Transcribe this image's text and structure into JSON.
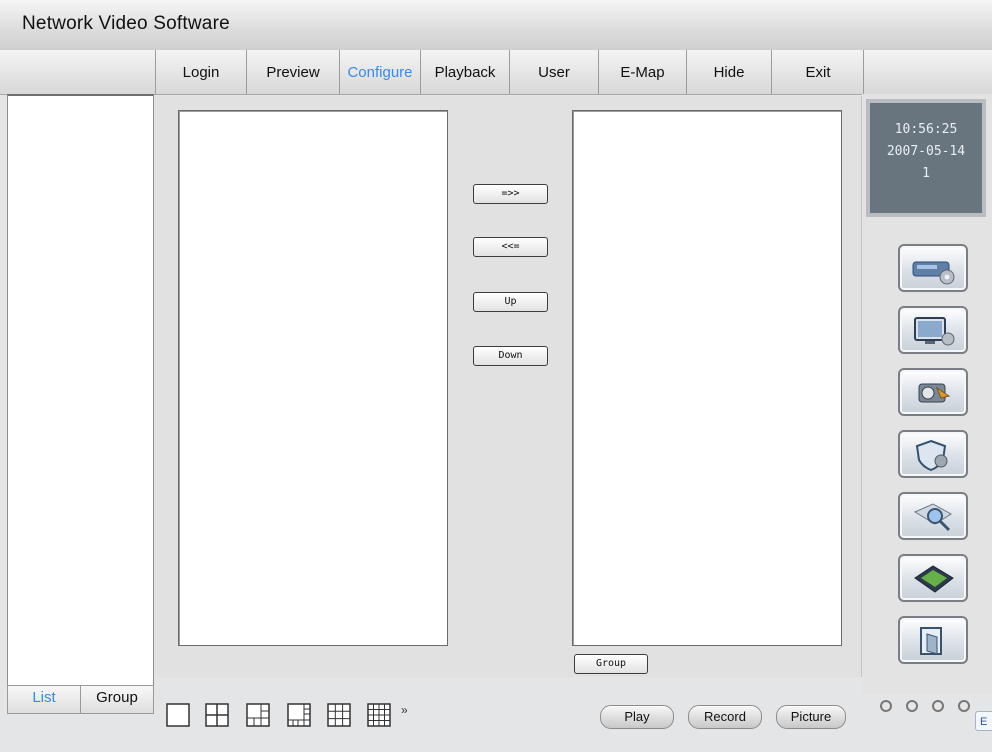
{
  "app": {
    "title": "Network Video Software"
  },
  "menu": {
    "items": [
      {
        "label": "Login"
      },
      {
        "label": "Preview"
      },
      {
        "label": "Configure",
        "active": true
      },
      {
        "label": "Playback"
      },
      {
        "label": "User"
      },
      {
        "label": "E-Map"
      },
      {
        "label": "Hide"
      },
      {
        "label": "Exit"
      }
    ]
  },
  "left_panel": {
    "tabs": [
      {
        "label": "List",
        "active": true
      },
      {
        "label": "Group"
      }
    ]
  },
  "transfer": {
    "add_label": "=>>",
    "remove_label": "<<=",
    "up_label": "Up",
    "down_label": "Down",
    "group_label": "Group"
  },
  "clock": {
    "time": "10:56:25",
    "date": "2007-05-14",
    "day": "1"
  },
  "side_buttons": [
    {
      "icon": "hardware-settings-icon"
    },
    {
      "icon": "monitor-settings-icon"
    },
    {
      "icon": "storage-settings-icon"
    },
    {
      "icon": "security-settings-icon"
    },
    {
      "icon": "search-icon"
    },
    {
      "icon": "map-icon"
    },
    {
      "icon": "exit-icon"
    }
  ],
  "layouts": [
    {
      "icon": "layout-1-icon"
    },
    {
      "icon": "layout-4-icon"
    },
    {
      "icon": "layout-6-icon"
    },
    {
      "icon": "layout-8-icon"
    },
    {
      "icon": "layout-9-icon"
    },
    {
      "icon": "layout-16-icon"
    }
  ],
  "layout_more": "»",
  "playback_controls": {
    "play_label": "Play",
    "record_label": "Record",
    "picture_label": "Picture"
  },
  "corner_label": "E",
  "colors": {
    "accent": "#3b8ae6",
    "clock_bg": "#68747e"
  }
}
